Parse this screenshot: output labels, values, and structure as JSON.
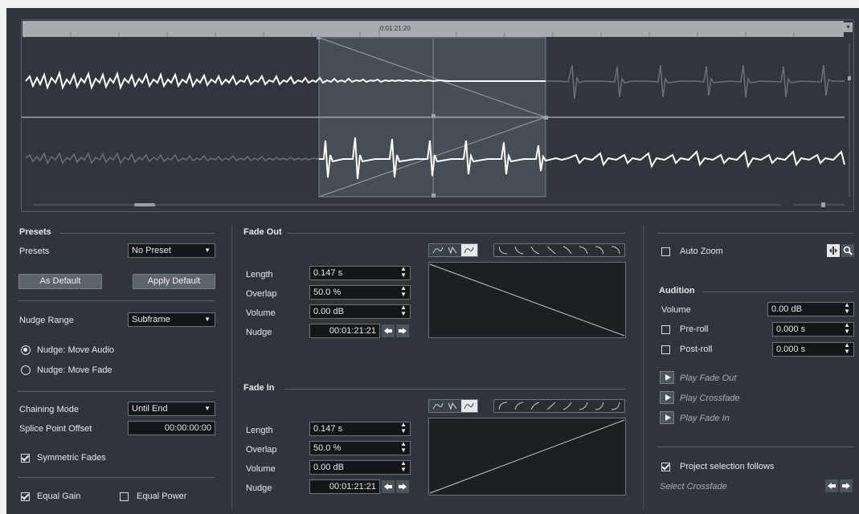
{
  "ruler": {
    "position": "0:01:21:20"
  },
  "presets": {
    "title": "Presets",
    "presets_label": "Presets",
    "presets_value": "No Preset",
    "as_default": "As Default",
    "apply_default": "Apply Default",
    "nudge_range_label": "Nudge Range",
    "nudge_range_value": "Subframe",
    "nudge_move_audio": "Nudge: Move Audio",
    "nudge_move_fade": "Nudge: Move Fade",
    "chaining_label": "Chaining Mode",
    "chaining_value": "Until End",
    "splice_label": "Splice Point Offset",
    "splice_value": "00:00:00:00",
    "symmetric": "Symmetric Fades",
    "equal_gain": "Equal Gain",
    "equal_power": "Equal Power"
  },
  "fade_out": {
    "title": "Fade Out",
    "length_label": "Length",
    "length": "0.147 s",
    "overlap_label": "Overlap",
    "overlap": "50.0 %",
    "volume_label": "Volume",
    "volume": "0.00 dB",
    "nudge_label": "Nudge",
    "nudge": "00:01:21:21"
  },
  "fade_in": {
    "title": "Fade In",
    "length_label": "Length",
    "length": "0.147 s",
    "overlap_label": "Overlap",
    "overlap": "50.0 %",
    "volume_label": "Volume",
    "volume": "0.00 dB",
    "nudge_label": "Nudge",
    "nudge": "00:01:21:21"
  },
  "right": {
    "auto_zoom": "Auto Zoom",
    "audition_title": "Audition",
    "volume_label": "Volume",
    "volume": "0.00 dB",
    "preroll_label": "Pre-roll",
    "preroll": "0.000 s",
    "postroll_label": "Post-roll",
    "postroll": "0.000 s",
    "play_fade_out": "Play Fade Out",
    "play_crossfade": "Play Crossfade",
    "play_fade_in": "Play Fade In",
    "project_selection": "Project selection follows",
    "select_crossfade": "Select Crossfade"
  },
  "colors": {
    "panel": "#2f353b",
    "input": "#141719",
    "wave_active": "#ffffff",
    "wave_inactive": "#6b7176"
  }
}
